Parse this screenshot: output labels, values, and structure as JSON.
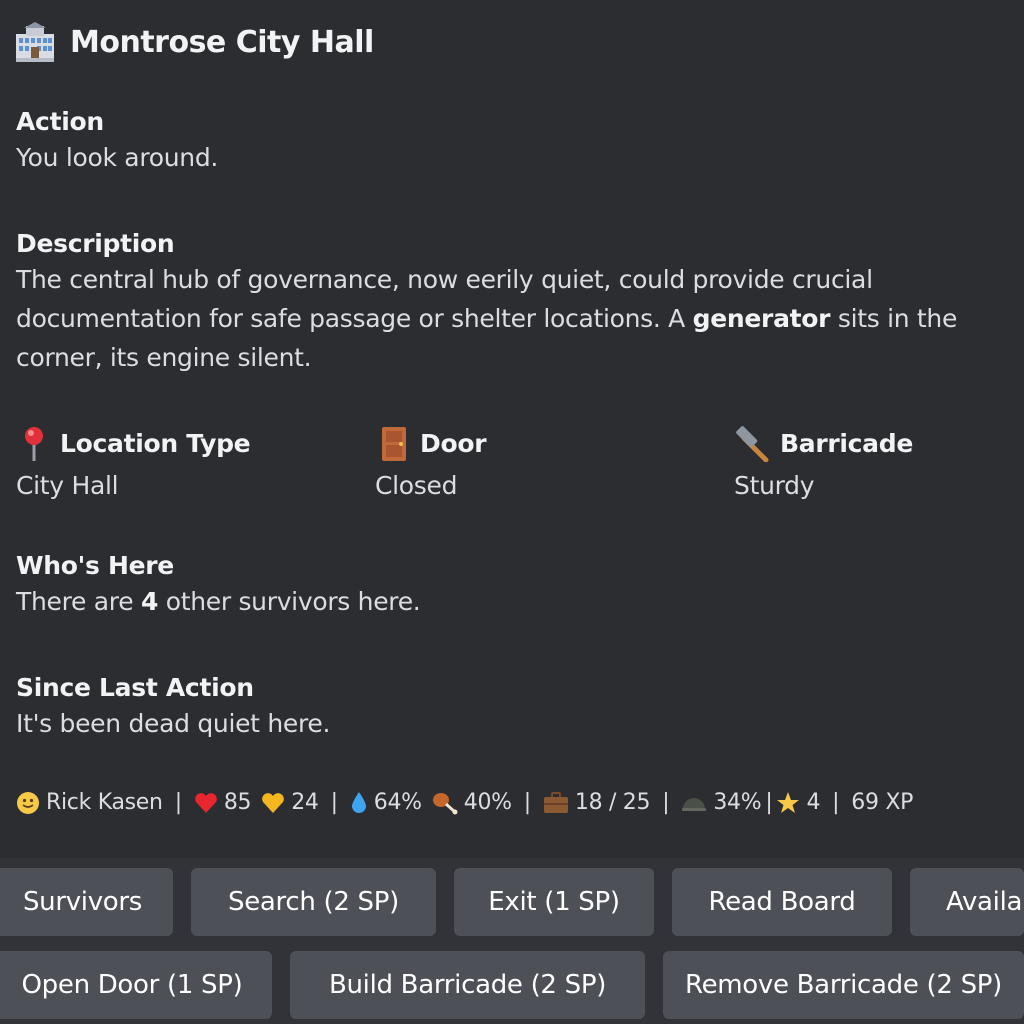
{
  "title": "Montrose City Hall",
  "action": {
    "label": "Action",
    "text": "You look around."
  },
  "description": {
    "label": "Description",
    "before": "The central hub of governance, now eerily quiet, could provide crucial documentation for safe passage or shelter locations. A ",
    "bold": "generator",
    "after": " sits in the corner, its engine silent."
  },
  "location_type": {
    "label": "Location Type",
    "value": "City Hall",
    "icon": "round-pushpin-icon"
  },
  "door": {
    "label": "Door",
    "value": "Closed",
    "icon": "door-icon"
  },
  "barricade": {
    "label": "Barricade",
    "value": "Sturdy",
    "icon": "hammer-icon"
  },
  "whos_here": {
    "label": "Who's Here",
    "before": "There are ",
    "count": "4",
    "after": " other survivors here."
  },
  "since_last": {
    "label": "Since Last Action",
    "text": "It's been dead quiet here."
  },
  "status": {
    "name": "Rick Kasen",
    "health": "85",
    "stamina": "24",
    "water": "64%",
    "food": "40%",
    "inventory": "18 / 25",
    "armor": "34%",
    "level": "4",
    "xp": "69 XP"
  },
  "buttons": {
    "row1": [
      "Survivors",
      "Search (2 SP)",
      "Exit (1 SP)",
      "Read Board",
      "Availa"
    ],
    "row2": [
      "Open Door (1 SP)",
      "Build Barricade (2 SP)",
      "Remove Barricade (2 SP)"
    ]
  },
  "colors": {
    "background": "#2b2d31",
    "button": "#4e5058",
    "button_area": "#313338"
  }
}
